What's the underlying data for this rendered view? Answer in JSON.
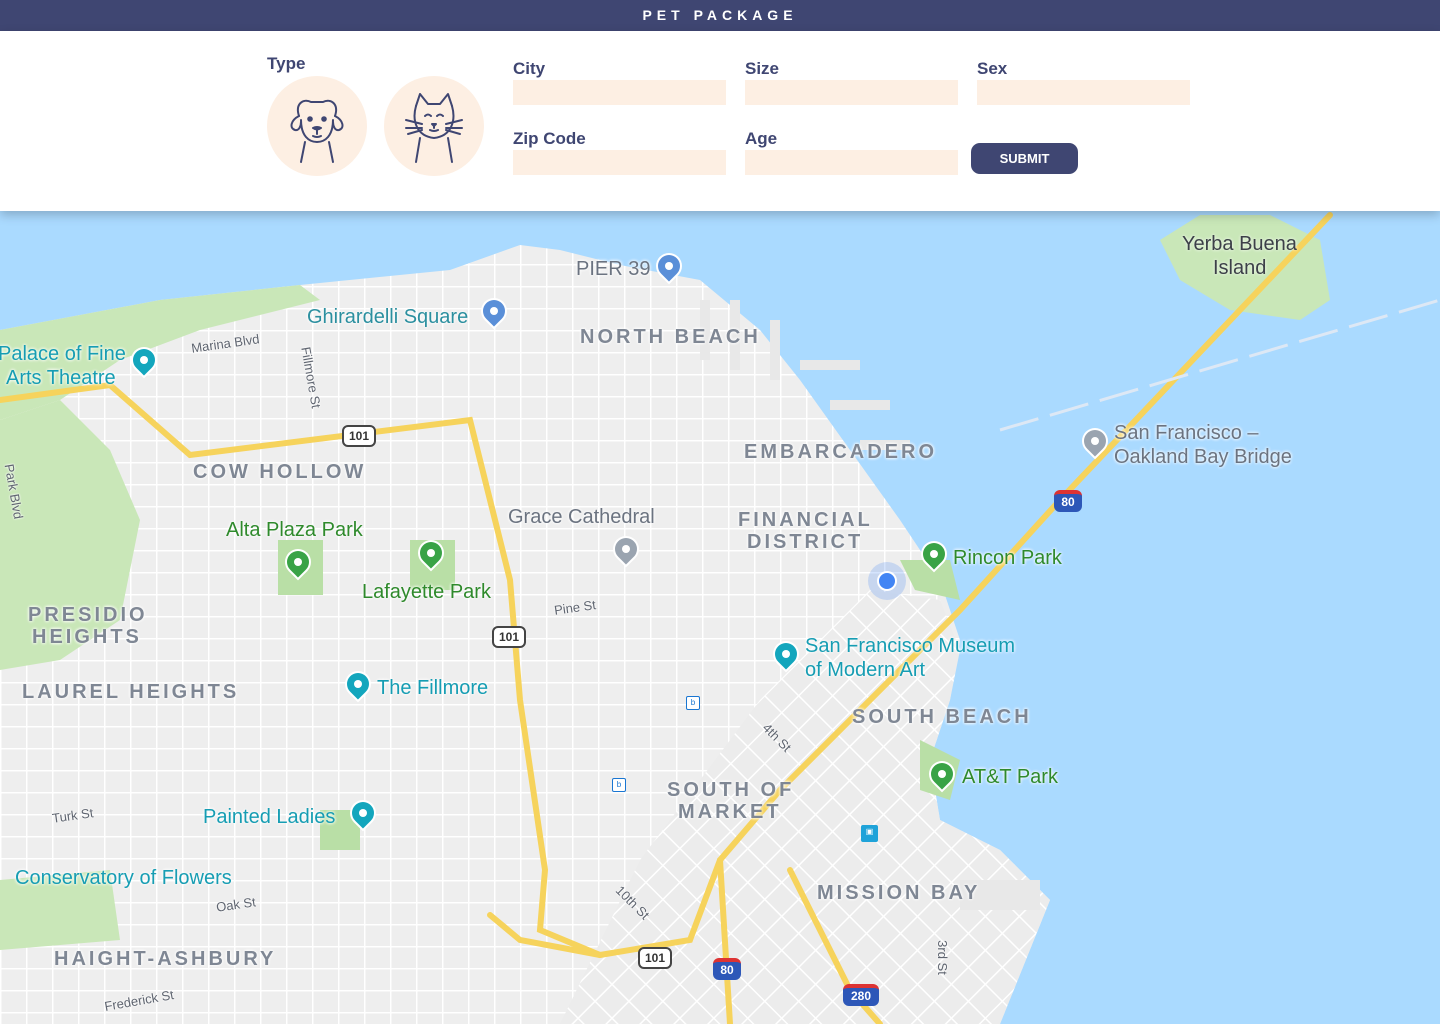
{
  "header": {
    "title": "PET PACKAGE"
  },
  "form": {
    "type_label": "Type",
    "pets": [
      {
        "name": "dog",
        "icon": "dog-icon"
      },
      {
        "name": "cat",
        "icon": "cat-icon"
      }
    ],
    "city_label": "City",
    "city_value": "",
    "size_label": "Size",
    "size_value": "",
    "sex_label": "Sex",
    "sex_value": "",
    "zip_label": "Zip Code",
    "zip_value": "",
    "age_label": "Age",
    "age_value": "",
    "submit_label": "SUBMIT"
  },
  "map": {
    "neighborhoods": {
      "north_beach": "NORTH BEACH",
      "embarcadero": "EMBARCADERO",
      "financial_district_1": "FINANCIAL",
      "financial_district_2": "DISTRICT",
      "cow_hollow": "COW HOLLOW",
      "presidio_heights_1": "PRESIDIO",
      "presidio_heights_2": "HEIGHTS",
      "laurel_heights": "LAUREL HEIGHTS",
      "south_beach": "SOUTH BEACH",
      "south_of_market_1": "SOUTH OF",
      "south_of_market_2": "MARKET",
      "mission_bay": "MISSION BAY",
      "haight_ashbury": "HAIGHT-ASHBURY"
    },
    "places": {
      "pier39": "PIER 39",
      "ghirardelli": "Ghirardelli Square",
      "palace_1": "Palace of Fine",
      "palace_2": "Arts Theatre",
      "alta_plaza": "Alta Plaza Park",
      "lafayette": "Lafayette Park",
      "grace": "Grace Cathedral",
      "rincon": "Rincon Park",
      "sfmoma_1": "San Francisco Museum",
      "sfmoma_2": "of Modern Art",
      "fillmore": "The Fillmore",
      "painted_ladies": "Painted Ladies",
      "conservatory": "Conservatory of Flowers",
      "att_park": "AT&T Park",
      "bay_bridge_1": "San Francisco –",
      "bay_bridge_2": "Oakland Bay Bridge",
      "yerba_1": "Yerba Buena",
      "yerba_2": "Island"
    },
    "streets": {
      "marina": "Marina Blvd",
      "fillmore_st": "Fillmore St",
      "pine": "Pine St",
      "fourth": "4th St",
      "tenth": "10th St",
      "turk": "Turk St",
      "oak": "Oak St",
      "frederick": "Frederick St",
      "third": "3rd St",
      "park_blvd": "Park Blvd"
    },
    "shields": {
      "us101": "101",
      "i80": "80",
      "i280": "280"
    }
  }
}
